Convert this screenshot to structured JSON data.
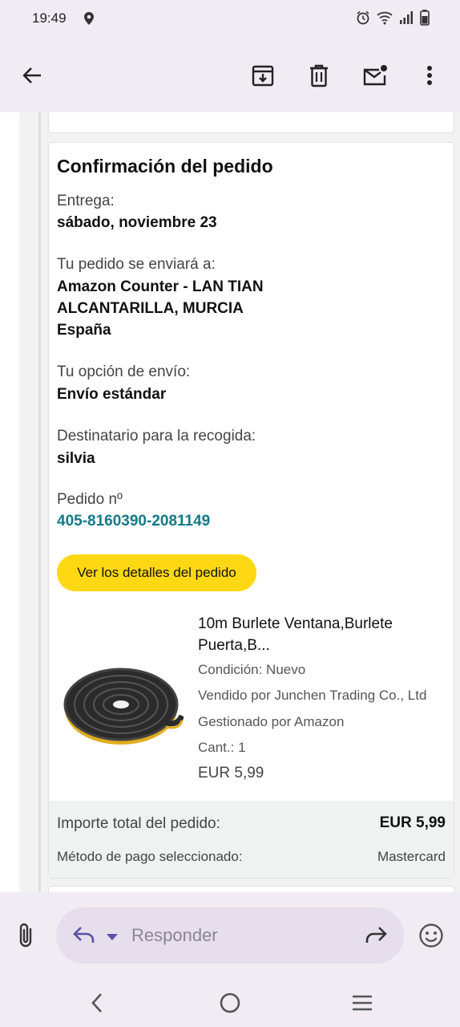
{
  "status_bar": {
    "time": "19:49",
    "icons": [
      "location-icon",
      "alarm-icon",
      "wifi-icon",
      "signal-icon",
      "battery-icon"
    ]
  },
  "toolbar": {
    "icons": [
      "back-arrow-icon",
      "archive-icon",
      "delete-icon",
      "mark-unread-icon",
      "more-vert-icon"
    ]
  },
  "order": {
    "title": "Confirmación del pedido",
    "delivery_label": "Entrega:",
    "delivery_date": "sábado, noviembre 23",
    "ship_to_label": "Tu pedido se enviará a:",
    "address_line1": "Amazon Counter - LAN TIAN",
    "address_line2": "ALCANTARILLA, MURCIA",
    "address_line3": "España",
    "shipping_option_label": "Tu opción de envío:",
    "shipping_option": "Envío estándar",
    "recipient_label": "Destinatario para la recogida:",
    "recipient": "silvia",
    "order_no_label": "Pedido nº",
    "order_no": "405-8160390-2081149",
    "details_button": "Ver los detalles del pedido"
  },
  "product": {
    "title": "10m Burlete Ventana,Burlete Puerta,B...",
    "condition": "Condición: Nuevo",
    "seller": "Vendido por Junchen Trading Co., Ltd",
    "fulfilled": "Gestionado por Amazon",
    "quantity": "Cant.: 1",
    "price": "EUR 5,99",
    "image": "weatherstrip-roll-image"
  },
  "totals": {
    "total_label": "Importe total del pedido:",
    "total_value": "EUR 5,99",
    "payment_label": "Método de pago seleccionado:",
    "payment_value": "Mastercard"
  },
  "reply": {
    "placeholder": "Responder",
    "icons": [
      "attach-icon",
      "reply-icon",
      "dropdown-icon",
      "forward-icon",
      "emoji-icon"
    ]
  },
  "nav": {
    "icons": [
      "nav-back-icon",
      "nav-home-icon",
      "nav-recents-icon"
    ]
  }
}
